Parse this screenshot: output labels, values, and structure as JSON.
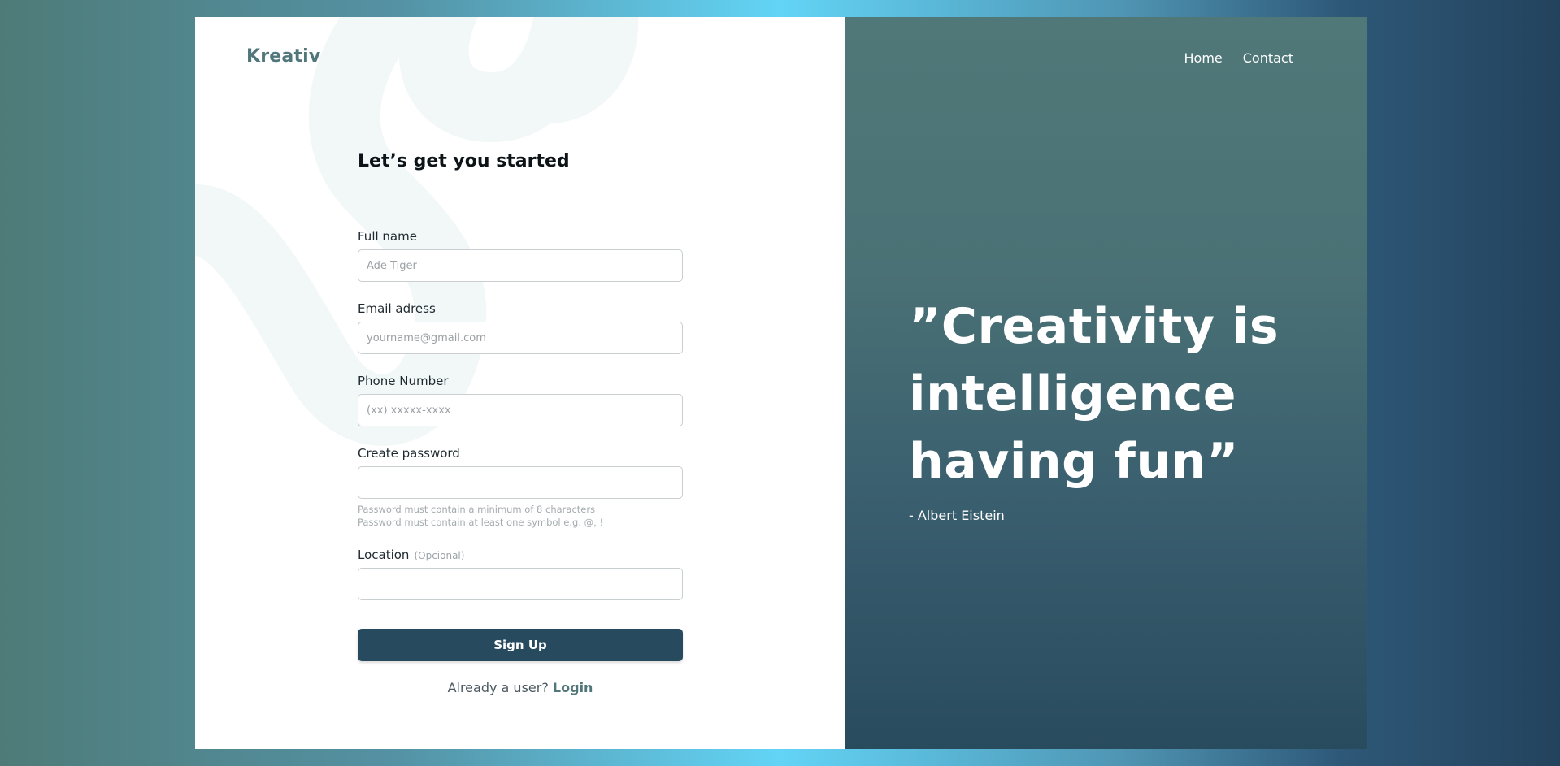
{
  "brand": {
    "logo": "Kreativ"
  },
  "nav": {
    "home": "Home",
    "contact": "Contact"
  },
  "form": {
    "title": "Let’s get you started",
    "fields": {
      "full_name": {
        "label": "Full name",
        "placeholder": "Ade Tiger",
        "value": ""
      },
      "email": {
        "label": "Email adress",
        "placeholder": "yourname@gmail.com",
        "value": ""
      },
      "phone": {
        "label": "Phone Number",
        "placeholder": "(xx) xxxxx-xxxx",
        "value": ""
      },
      "password": {
        "label": "Create password",
        "placeholder": "",
        "value": "",
        "hint_1": "Password must contain a minimum of 8 characters",
        "hint_2": "Password must contain at least one symbol e.g. @, !"
      },
      "location": {
        "label": "Location",
        "optional_tag": "(Opcional)",
        "placeholder": "",
        "value": ""
      }
    },
    "submit_label": "Sign Up",
    "login_prompt": "Already a user?",
    "login_link": "Login"
  },
  "quote": {
    "line_1": "”Creativity is",
    "line_2": "intelligence",
    "line_3": "having fun”",
    "author": "- Albert Eistein"
  },
  "colors": {
    "brand": "#52777b",
    "button": "#284a5e",
    "panel_top": "#507878",
    "panel_bottom": "#294b5e"
  }
}
